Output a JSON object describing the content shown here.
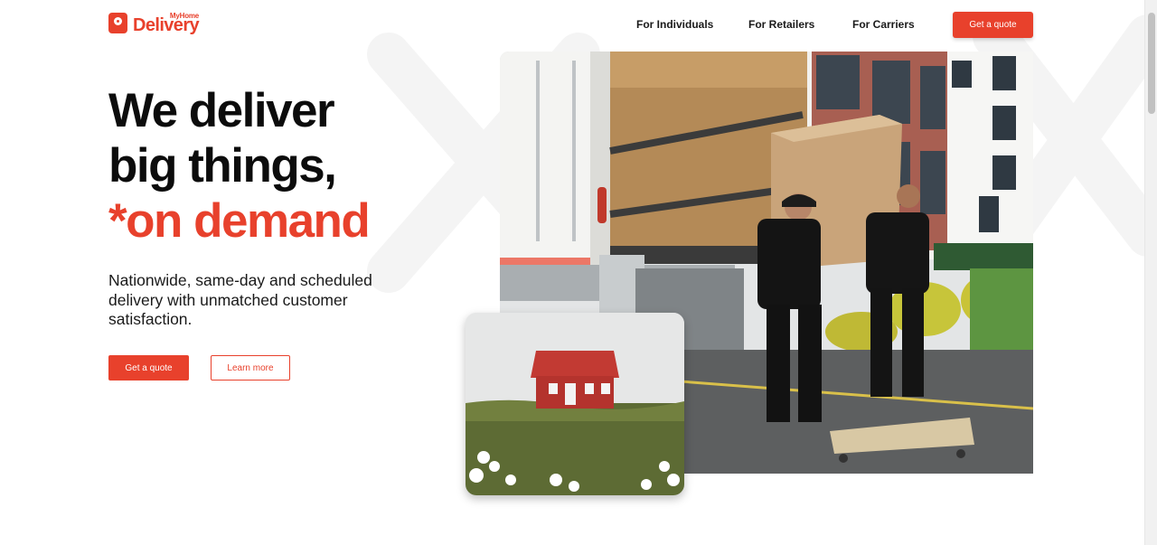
{
  "brand": {
    "logo_small": "MyHome",
    "logo_main": "Delivery",
    "accent_color": "#e8412c"
  },
  "nav": {
    "items": [
      {
        "label": "For Individuals"
      },
      {
        "label": "For Retailers"
      },
      {
        "label": "For Carriers"
      }
    ],
    "cta_label": "Get a quote"
  },
  "hero": {
    "title_line1": "We deliver",
    "title_line2": "big things,",
    "title_accent": "*on demand",
    "subtitle": "Nationwide, same-day and scheduled delivery with unmatched customer satisfaction.",
    "primary_button": "Get a quote",
    "secondary_button": "Learn more"
  },
  "images": {
    "main": "movers-unloading-truck-photo",
    "secondary": "red-house-on-hill-photo"
  }
}
